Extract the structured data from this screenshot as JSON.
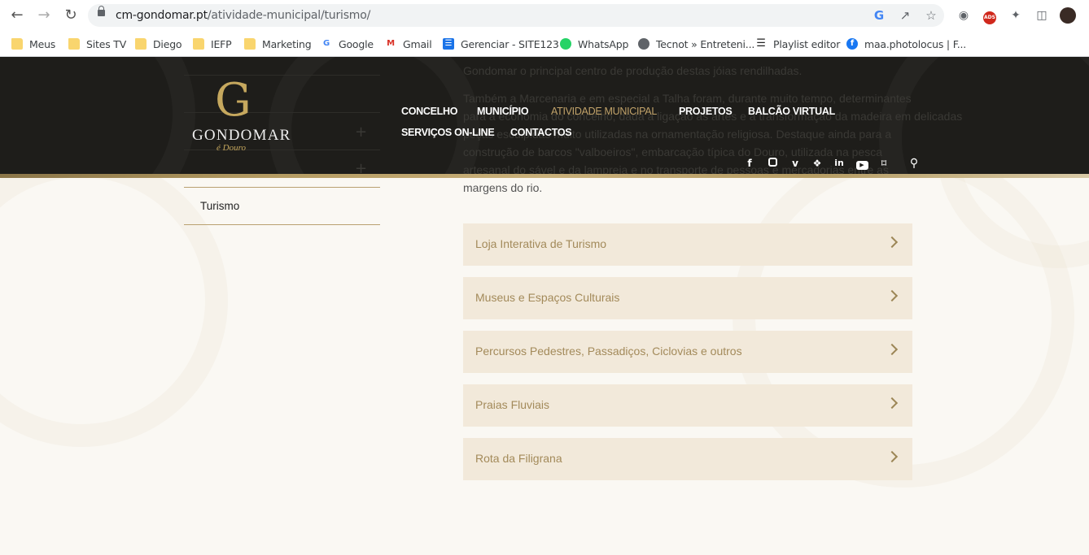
{
  "browser": {
    "url_domain": "cm-gondomar.pt",
    "url_path": "/atividade-municipal/turismo/",
    "bookmarks": [
      {
        "label": "Meus",
        "icon": "folder-icon"
      },
      {
        "label": "Sites TV",
        "icon": "folder-icon"
      },
      {
        "label": "Diego",
        "icon": "folder-icon"
      },
      {
        "label": "IEFP",
        "icon": "folder-icon"
      },
      {
        "label": "Marketing",
        "icon": "folder-icon"
      },
      {
        "label": "Google",
        "icon": "google-icon"
      },
      {
        "label": "Gmail",
        "icon": "gmail-icon"
      },
      {
        "label": "Gerenciar - SITE123",
        "icon": "site123-icon"
      },
      {
        "label": "WhatsApp",
        "icon": "whatsapp-icon"
      },
      {
        "label": "Tecnot » Entreteni...",
        "icon": "globe-icon"
      },
      {
        "label": "Playlist editor",
        "icon": "list-icon"
      },
      {
        "label": "maa.photolocus | F...",
        "icon": "facebook-icon"
      }
    ]
  },
  "header": {
    "logo_letter": "G",
    "logo_name": "GONDOMAR",
    "logo_sub": "é Douro",
    "menu": [
      {
        "label": "CONCELHO",
        "active": false
      },
      {
        "label": "MUNICÍPIO",
        "active": false
      },
      {
        "label": "ATIVIDADE MUNICIPAL",
        "active": true
      },
      {
        "label": "PROJETOS",
        "active": false
      },
      {
        "label": "BALCÃO VIRTUAL",
        "active": false
      },
      {
        "label": "SERVIÇOS ON-LINE",
        "active": false
      },
      {
        "label": "CONTACTOS",
        "active": false
      }
    ],
    "social": [
      "facebook-icon",
      "instagram-icon",
      "vimeo-icon",
      "twitter-icon",
      "linkedin-icon",
      "youtube-icon",
      "rss-icon",
      "search-icon"
    ],
    "background_text": [
      "Gondomar o principal centro de produção destas jóias rendilhadas.",
      "Também a Marcenaria e em especial a Talha foram, durante muito tempo, determinantes",
      "para a economia do concelho, dada a ligação às artes e a transformação da madeira em delicadas",
      "peças esculpidas muito utilizadas na ornamentação religiosa. Destaque ainda para a",
      "construção de barcos \"valboeiros\", embarcação típica do Douro, utilizada na pesca",
      "artesanal do sável e da lampreia e no transporte de pessoas e mercadorias entre as"
    ]
  },
  "sidebar": {
    "current": "Turismo"
  },
  "content": {
    "intro_tail": "margens do rio.",
    "links": [
      "Loja Interativa de Turismo",
      "Museus e Espaços Culturais",
      "Percursos Pedestres, Passadiços, Ciclovias e outros",
      "Praias Fluviais",
      "Rota da Filigrana"
    ]
  },
  "colors": {
    "header_bg": "#1e1d1a",
    "accent_gold": "#c2a36a",
    "link_box_bg": "#f2e9da",
    "link_text": "#a38a5a",
    "page_bg": "#faf8f3"
  }
}
